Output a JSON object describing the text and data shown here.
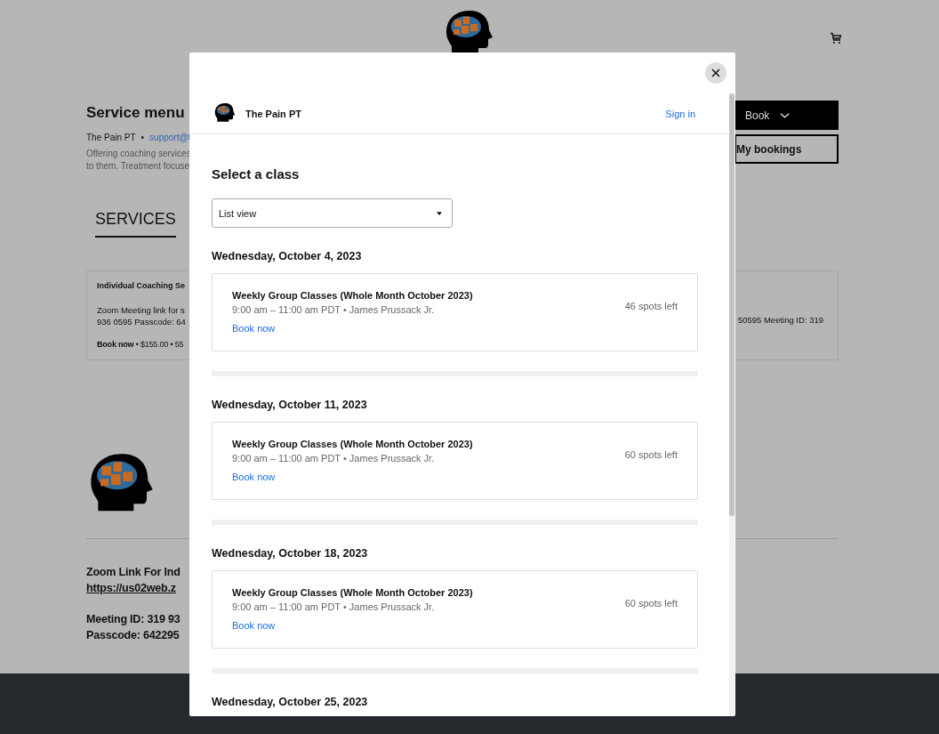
{
  "page": {
    "title": "Service menu",
    "business": "The Pain PT",
    "separator": "•",
    "email": "support@t",
    "description": [
      "Offering coaching services",
      "to them. Treatment focuse"
    ],
    "tabs": [
      {
        "label": "SERVICES",
        "selected": true
      }
    ],
    "buttons": [
      {
        "label": "Book",
        "kind": "dropdown"
      },
      {
        "label": "My bookings",
        "kind": "outline"
      }
    ],
    "service_card": {
      "title": "Individual Coaching Se",
      "details": [
        "Zoom Meeting link for s",
        "936 0595 Passcode: 64"
      ],
      "details_right": "50595 Meeting ID: 319",
      "meta": "**Book now** • $155.00 • 55"
    },
    "footer_info": {
      "zoom_label": "Zoom Link For Ind",
      "zoom_link": "https://us02web.z",
      "meeting_id": "Meeting ID: 319 93",
      "passcode": "Passcode: 642295"
    }
  },
  "modal": {
    "business": "The Pain PT",
    "sign_in": "Sign in",
    "heading": "Select a class",
    "view_select": "List view",
    "days": [
      {
        "date": "Wednesday, October 4, 2023",
        "classes": [
          {
            "title": "Weekly Group Classes (Whole Month October 2023)",
            "time": "9:00 am – 11:00 am PDT • James Prussack Jr.",
            "book": "Book now",
            "spots": "46 spots left"
          }
        ]
      },
      {
        "date": "Wednesday, October 11, 2023",
        "classes": [
          {
            "title": "Weekly Group Classes (Whole Month October 2023)",
            "time": "9:00 am – 11:00 am PDT • James Prussack Jr.",
            "book": "Book now",
            "spots": "60 spots left"
          }
        ]
      },
      {
        "date": "Wednesday, October 18, 2023",
        "classes": [
          {
            "title": "Weekly Group Classes (Whole Month October 2023)",
            "time": "9:00 am – 11:00 am PDT • James Prussack Jr.",
            "book": "Book now",
            "spots": "60 spots left"
          }
        ]
      },
      {
        "date": "Wednesday, October 25, 2023"
      }
    ]
  }
}
